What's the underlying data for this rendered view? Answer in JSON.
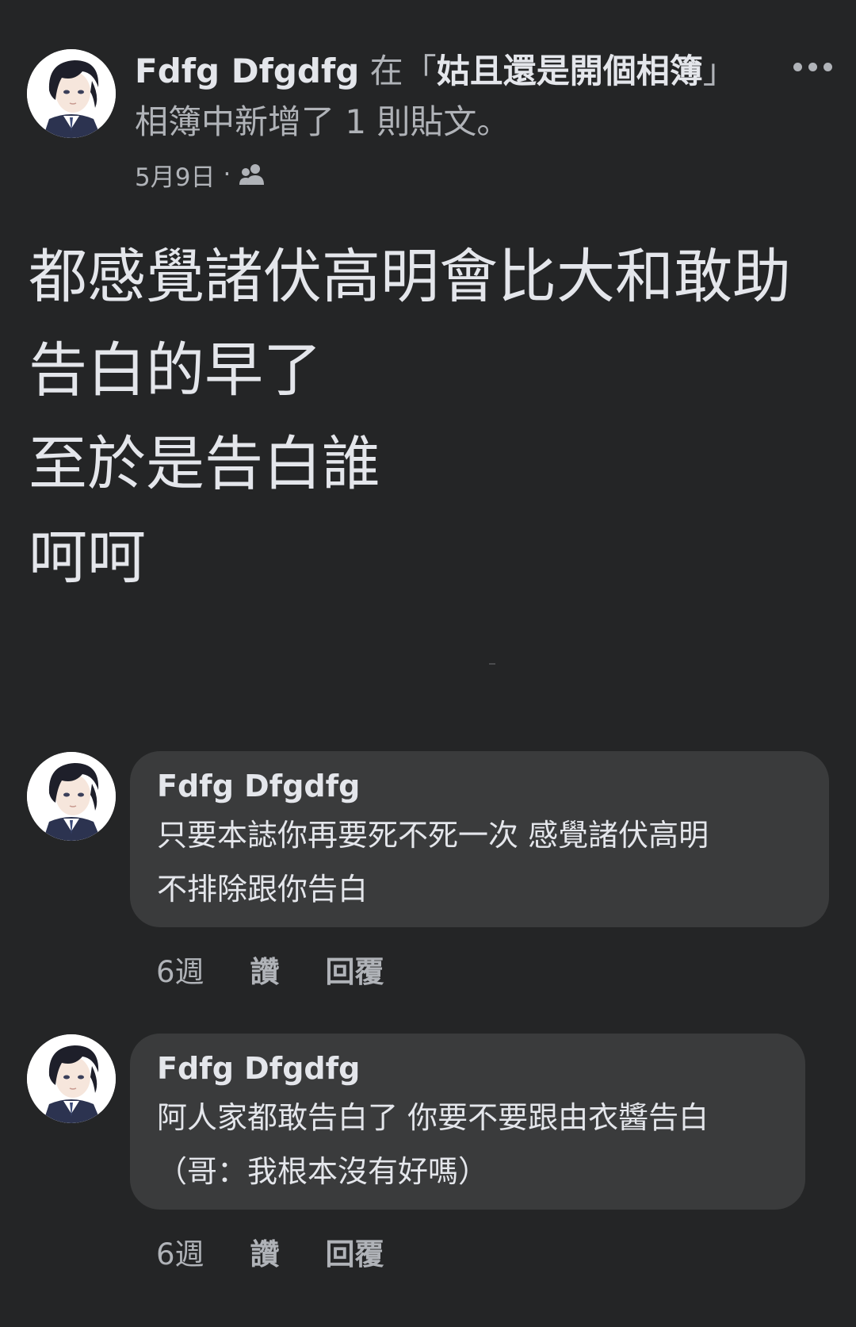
{
  "post": {
    "author": "Fdfg Dfgdfg",
    "header_prefix": " 在「",
    "album": "姑且還是開個相簿",
    "header_suffix": "」相簿中新增了 1 則貼文。",
    "date": "5月9日",
    "separator": "·",
    "privacy_icon": "friends-icon",
    "body_lines": [
      "都感覺諸伏高明會比大和敢助",
      "告白的早了",
      "至於是告白誰",
      "呵呵"
    ]
  },
  "comments": [
    {
      "author": "Fdfg Dfgdfg",
      "text_lines": [
        "只要本誌你再要死不死一次 感覺諸伏高明",
        "不排除跟你告白"
      ],
      "time": "6週",
      "like_label": "讚",
      "reply_label": "回覆"
    },
    {
      "author": "Fdfg Dfgdfg",
      "text_lines": [
        "阿人家都敢告白了 你要不要跟由衣醬告白",
        "（哥：我根本沒有好嗎）"
      ],
      "time": "6週",
      "like_label": "讚",
      "reply_label": "回覆"
    }
  ],
  "colors": {
    "background": "#242526",
    "bubble": "#3a3b3c",
    "primary_text": "#e4e6eb",
    "secondary_text": "#b0b3b8"
  }
}
